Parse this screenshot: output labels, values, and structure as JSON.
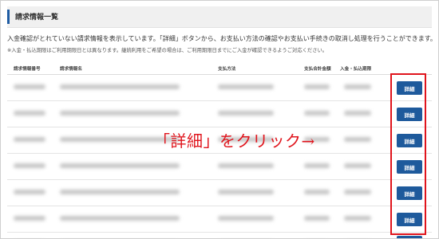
{
  "header": {
    "title": "請求情報一覧"
  },
  "description": "入金確認がとれていない請求情報を表示しています。「詳細」ボタンから、お支払い方法の確認やお支払い手続きの取消し処理を行うことができます。",
  "note": "※入金・払込期限はご利用期限日とは異なります。継続利用をご希望の場合は、ご利用期限日までにご入金が確認できるようご対応ください。",
  "table": {
    "columns": {
      "billing_no": "請求情報番号",
      "billing_name": "請求情報名",
      "payment_method": "支払方法",
      "total": "支払合計金額",
      "deadline": "入金・払込期限"
    },
    "detail_label": "詳細",
    "row_count_visible": 7
  },
  "annotation": "「詳細」をクリック→",
  "colors": {
    "accent": "#1e5a9c",
    "highlight": "#e0141c"
  }
}
